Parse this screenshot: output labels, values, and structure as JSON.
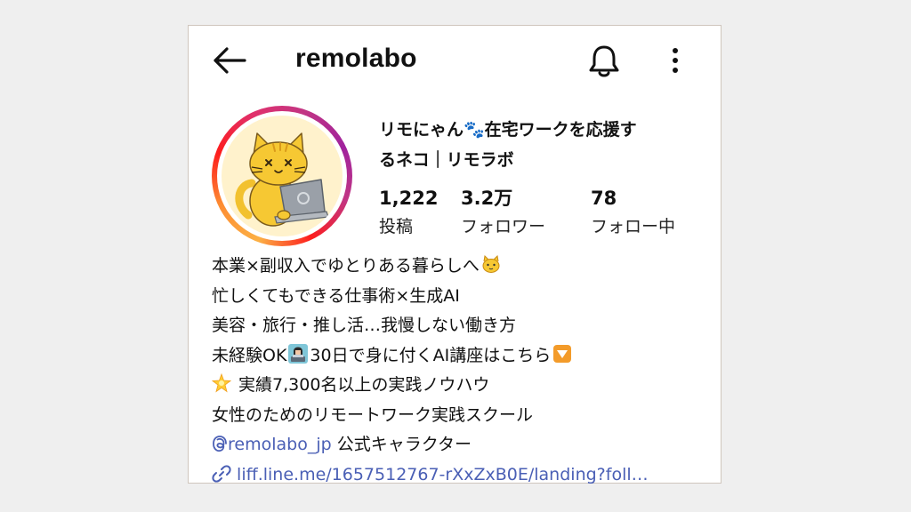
{
  "header": {
    "username": "remolabo",
    "back_icon": "arrow-left-icon",
    "notification_icon": "bell-icon",
    "menu_icon": "more-vertical-icon"
  },
  "profile": {
    "avatar_icon": "cat-with-laptop-avatar",
    "display_name_line1": "リモにゃん🐾在宅ワークを応援す",
    "display_name_line2": "るネコ｜リモラボ",
    "stats": {
      "posts_count": "1,222",
      "posts_label": "投稿",
      "followers_count": "3.2万",
      "followers_label": "フォロワー",
      "following_count": "78",
      "following_label": "フォロー中"
    }
  },
  "bio": {
    "line1": "本業×副収入でゆとりある暮らしへ",
    "line1_emoji": "cat-face-icon",
    "line2": "忙しくてもできる仕事術×生成AI",
    "line3": "美容・旅行・推し活…我慢しない働き方",
    "line4_a": "未経験OK",
    "line4_emoji": "woman-technologist-icon",
    "line4_b": "30日で身に付くAI講座はこちら",
    "line4_emoji2": "down-arrow-button-icon",
    "line5_emoji": "glowing-star-icon",
    "line5": " 実績7,300名以上の実践ノウハウ",
    "line6": "女性のためのリモートワーク実践スクール",
    "threads_handle": "remolabo_jp",
    "threads_suffix": " 公式キャラクター",
    "link_text": "liff.line.me/1657512767-rXxZxB0E/landing?foll…"
  },
  "colors": {
    "background": "#efefef",
    "card": "#ffffff",
    "card_border": "#cfc6bd",
    "link": "#4a5fb5",
    "ring_gradient": [
      "#fcb045",
      "#fd1d1d",
      "#c13584"
    ]
  }
}
